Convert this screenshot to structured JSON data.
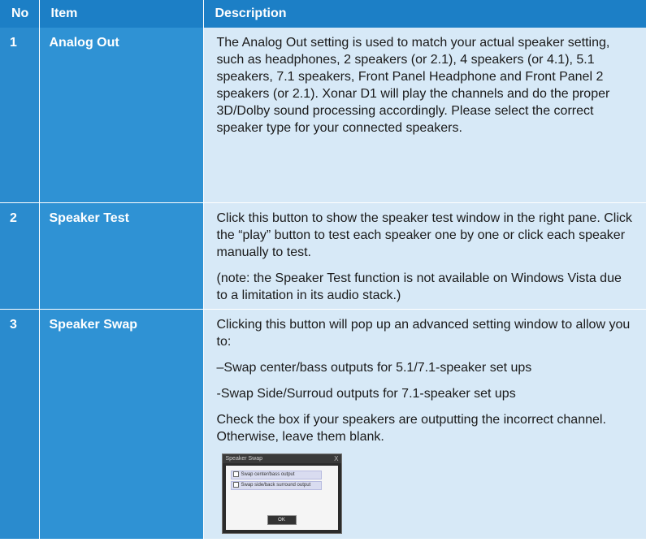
{
  "header": {
    "no": "No",
    "item": "Item",
    "description": "Description"
  },
  "rows": [
    {
      "no": "1",
      "item": "Analog Out",
      "paragraphs": [
        "The Analog Out setting is used to match your actual speaker setting, such as headphones, 2 speakers (or 2.1), 4 speakers (or 4.1), 5.1 speakers, 7.1 speakers, Front Panel Headphone and Front Panel 2 speakers (or 2.1). Xonar D1 will play the channels and do the proper 3D/Dolby sound processing accordingly. Please select the correct speaker type for your connected speakers."
      ]
    },
    {
      "no": "2",
      "item": "Speaker Test",
      "paragraphs": [
        "Click this button to show the speaker test window in the right pane. Click the “play” button to test each speaker one by one or click each speaker manually to test.",
        "(note: the Speaker Test function is not available on Windows Vista due to a limitation in its audio stack.)"
      ]
    },
    {
      "no": "3",
      "item": "Speaker Swap",
      "paragraphs": [
        "Clicking this button will pop up an advanced setting window to allow you to:",
        "–Swap center/bass outputs for 5.1/7.1-speaker set ups",
        "-Swap Side/Surroud outputs for 7.1-speaker set ups",
        "Check the box if your speakers are outputting the incorrect channel. Otherwise, leave them blank."
      ],
      "screenshot": {
        "title": "Speaker Swap",
        "close": "X",
        "option1": "Swap center/bass output",
        "option2": "Swap side/back surround output",
        "ok": "OK"
      }
    }
  ]
}
